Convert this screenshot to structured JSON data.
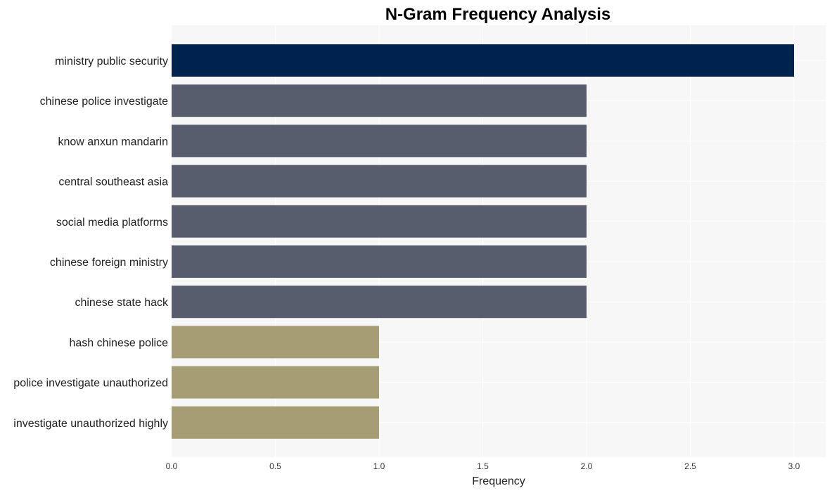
{
  "chart_data": {
    "type": "bar",
    "orientation": "horizontal",
    "title": "N-Gram Frequency Analysis",
    "xlabel": "Frequency",
    "ylabel": "",
    "xlim": [
      0,
      3.15
    ],
    "xticks": [
      0.0,
      0.5,
      1.0,
      1.5,
      2.0,
      2.5,
      3.0
    ],
    "xtick_labels": [
      "0.0",
      "0.5",
      "1.0",
      "1.5",
      "2.0",
      "2.5",
      "3.0"
    ],
    "grid": true,
    "categories": [
      "ministry public security",
      "chinese police investigate",
      "know anxun mandarin",
      "central southeast asia",
      "social media platforms",
      "chinese foreign ministry",
      "chinese state hack",
      "hash chinese police",
      "police investigate unauthorized",
      "investigate unauthorized highly"
    ],
    "values": [
      3,
      2,
      2,
      2,
      2,
      2,
      2,
      1,
      1,
      1
    ],
    "colors": {
      "3": "#00224e",
      "2": "#575d6d",
      "1": "#a69d75"
    },
    "background": "#f7f7f7",
    "gridline_color": "#ffffff"
  }
}
